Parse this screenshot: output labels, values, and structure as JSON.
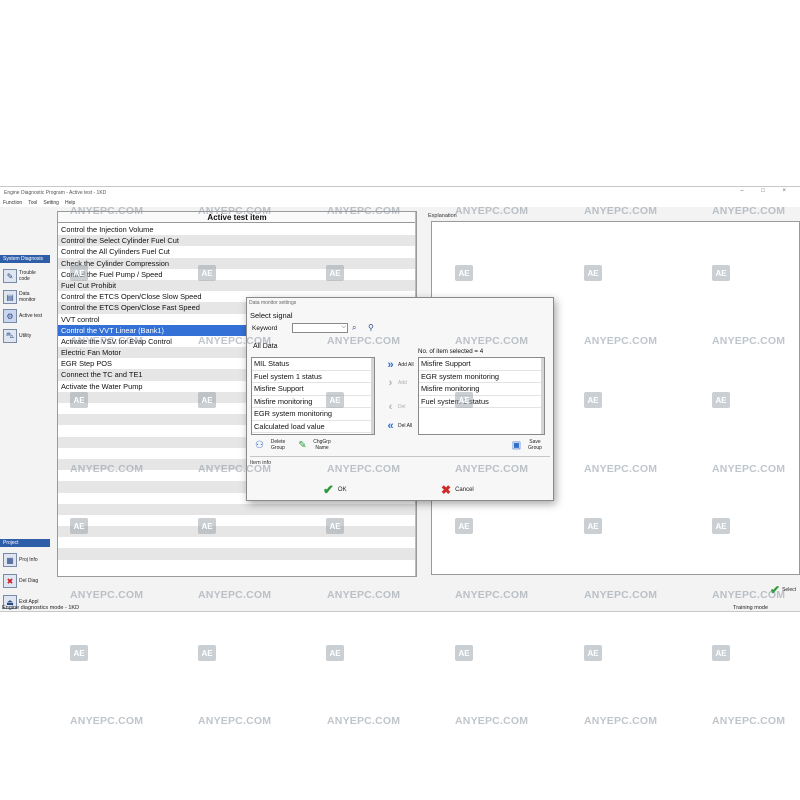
{
  "window": {
    "title": "Engine Diagnostic Program - Active test - 1KD",
    "controls": "– □ ×"
  },
  "menu": [
    "Function",
    "Tool",
    "Setting",
    "Help"
  ],
  "sidebar": {
    "section_title": "System Diagnosis",
    "items": [
      {
        "label": "Trouble code",
        "icon": "wrench-icon"
      },
      {
        "label": "Data monitor",
        "icon": "monitor-icon"
      },
      {
        "label": "Active test",
        "icon": "active-test-icon"
      },
      {
        "label": "Utility",
        "icon": "car-lift-icon"
      }
    ],
    "project_title": "Project",
    "project_items": [
      {
        "label": "Proj Info",
        "icon": "project-info-icon"
      },
      {
        "label": "Del Diag",
        "icon": "delete-diag-icon"
      },
      {
        "label": "Exit Appl",
        "icon": "exit-icon"
      }
    ]
  },
  "active_test": {
    "header": "Active test item",
    "items": [
      "Control the Injection Volume",
      "Control the Select Cylinder Fuel Cut",
      "Control the All Cylinders Fuel Cut",
      "Check the Cylinder Compression",
      "Control the Fuel Pump / Speed",
      "Fuel Cut Prohibit",
      "Control the ETCS Open/Close Slow Speed",
      "Control the ETCS Open/Close Fast Speed",
      "VVT control",
      "Control the VVT Linear (Bank1)",
      "Activate the VSV for Evap Control",
      "Electric Fan Motor",
      "EGR Step POS",
      "Connect the TC and TE1",
      "Activate the Water Pump",
      "",
      "",
      "",
      "",
      "",
      "",
      "",
      "",
      "",
      "",
      "",
      "",
      "",
      "",
      ""
    ],
    "selected_index": 9
  },
  "explanation": {
    "label": "Explanation"
  },
  "dialog": {
    "title": "Data monitor settings",
    "select_signal": "Select signal",
    "keyword_label": "Keyword",
    "keyword_value": "",
    "category": "All Data",
    "available": [
      "MIL Status",
      "Fuel system 1 status",
      "Misfire Support",
      "Misfire monitoring",
      "EGR system monitoring",
      "Calculated load value"
    ],
    "buttons": {
      "add_all": "Add All",
      "add": "Add",
      "del": "Del",
      "del_all": "Del All",
      "delete_group": "Delete Group",
      "chg_grp_name": "ChgGrp Name",
      "save_group": "Save Group",
      "ok": "OK",
      "cancel": "Cancel"
    },
    "selected_count_label": "No. of item selected = 4",
    "selected": [
      "Misfire Support",
      "EGR system monitoring",
      "Misfire monitoring",
      "Fuel system 1 status"
    ],
    "item_info_label": "Item info"
  },
  "status": {
    "left": "Engine diagnostics mode  -  1KD",
    "right": "Training mode",
    "select_label": "Select"
  },
  "watermark": {
    "text": "ANYEPC.COM",
    "logo": "AE"
  }
}
